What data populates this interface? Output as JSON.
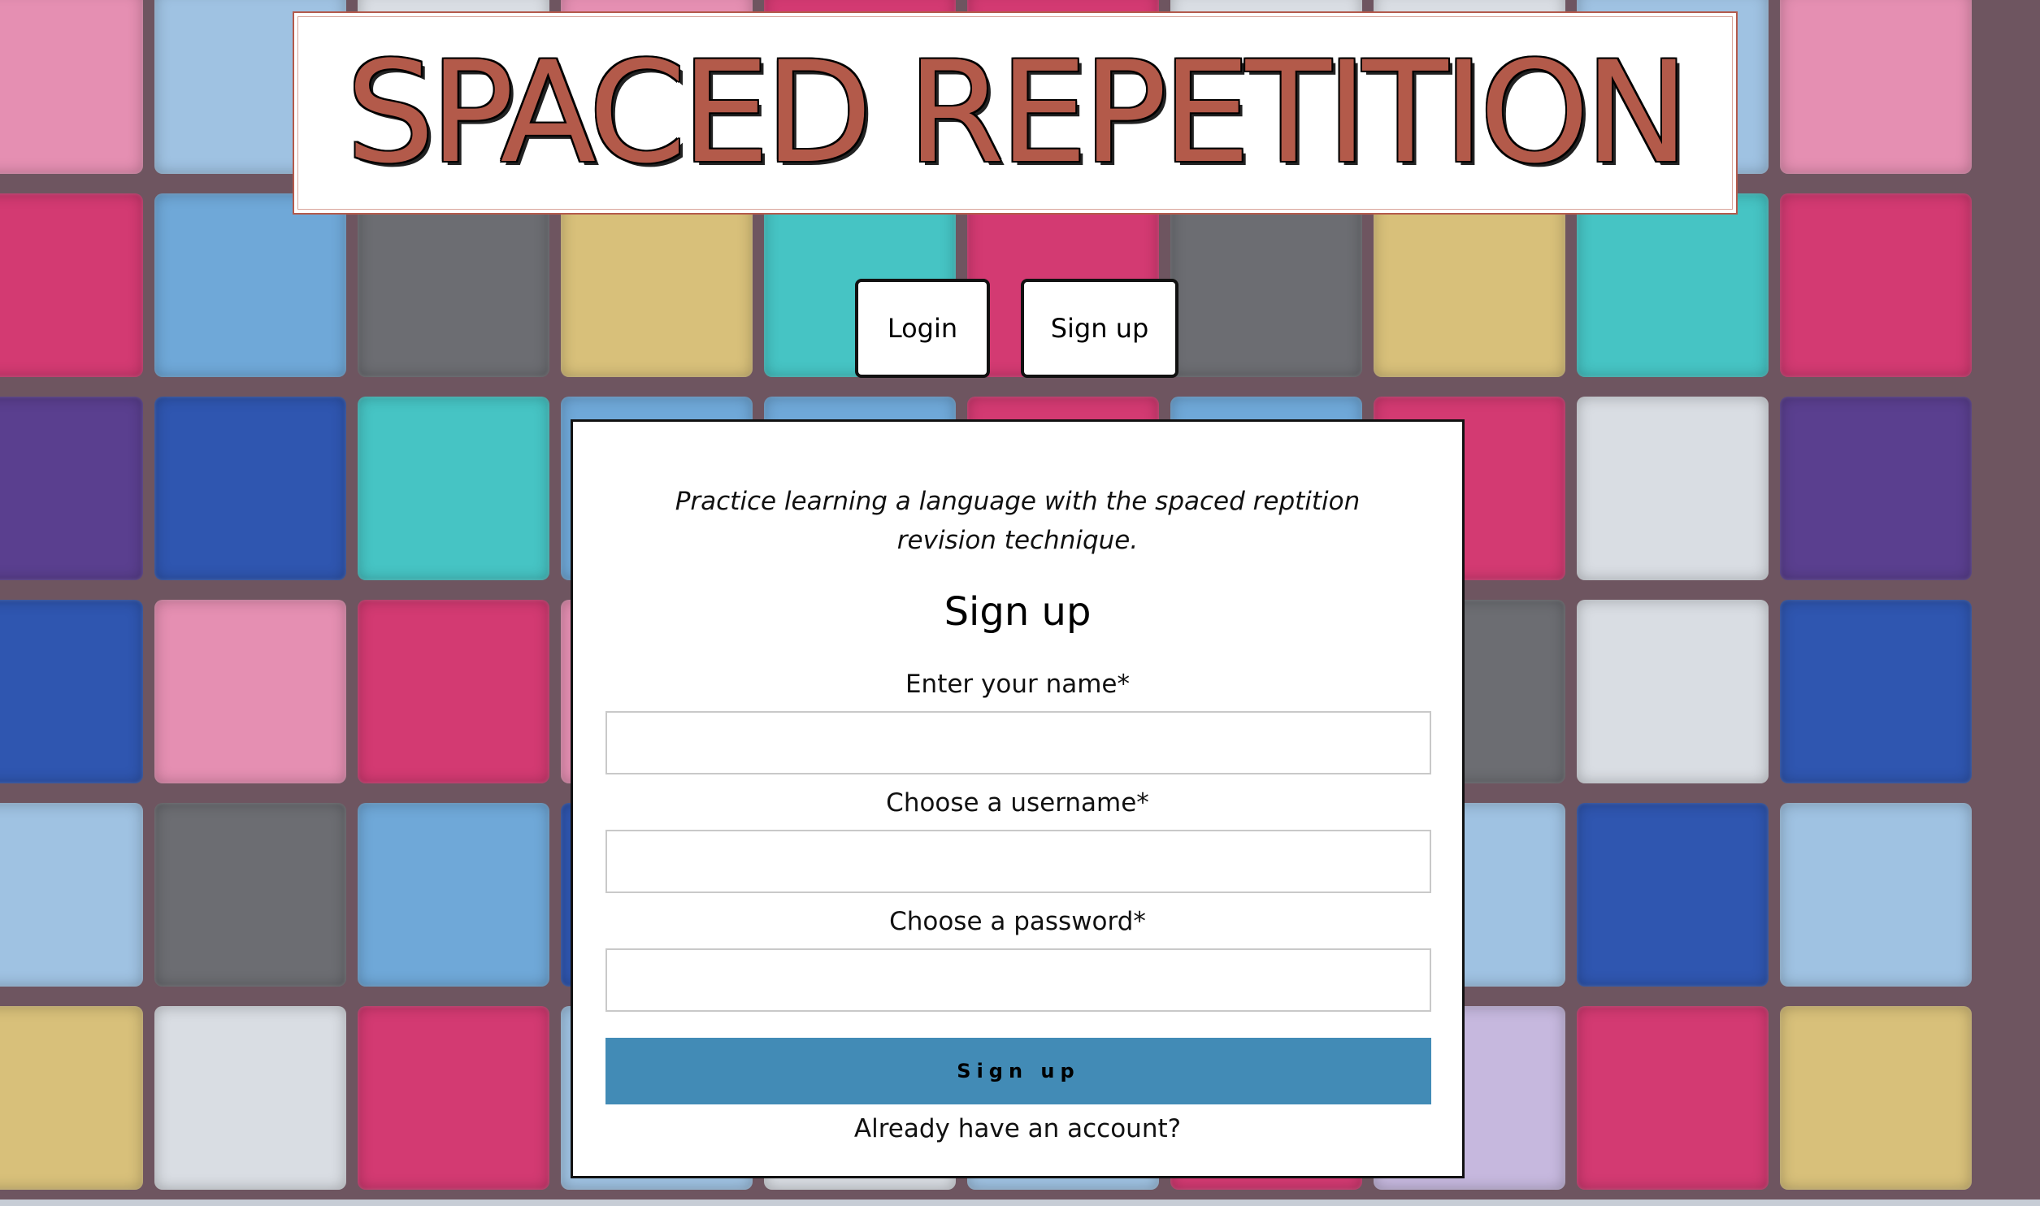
{
  "header": {
    "title": "SPACED REPETITION"
  },
  "nav": {
    "login_label": "Login",
    "signup_label": "Sign up"
  },
  "card": {
    "tagline": "Practice learning a language with the spaced reptition revision technique.",
    "form_title": "Sign up",
    "fields": [
      {
        "label": "Enter your name*",
        "value": "",
        "placeholder": ""
      },
      {
        "label": "Choose a username*",
        "value": "",
        "placeholder": ""
      },
      {
        "label": "Choose a password*",
        "value": "",
        "placeholder": ""
      }
    ],
    "submit_label": "Sign up",
    "account_link": "Already have an account?"
  },
  "colors": {
    "title": "#b35a4a",
    "submit_button": "#428bb6",
    "card_background": "#ffffff"
  }
}
